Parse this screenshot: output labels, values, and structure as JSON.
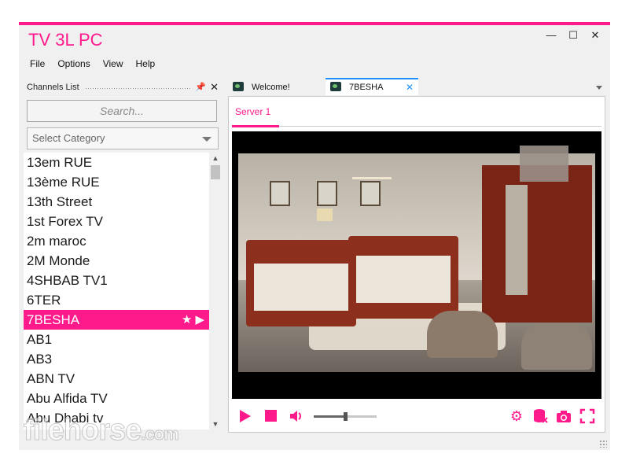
{
  "app": {
    "title": "TV 3L PC",
    "window_controls": {
      "minimize": "—",
      "maximize": "☐",
      "close": "✕"
    }
  },
  "menu": [
    "File",
    "Options",
    "View",
    "Help"
  ],
  "channels_panel": {
    "title": "Channels List",
    "pin_icon": "📌",
    "close_icon": "✕",
    "search_placeholder": "Search...",
    "category_label": "Select Category",
    "channels": [
      "13em RUE",
      "13ème RUE",
      "13th Street",
      "1st Forex TV",
      "2m maroc",
      "2M Monde",
      "4SHBAB TV1",
      "6TER",
      "7BESHA",
      "AB1",
      "AB3",
      "ABN TV",
      "Abu Alfida TV",
      "Abu Dhabi tv"
    ],
    "selected_channel": "7BESHA",
    "selected_actions": "★ ▶"
  },
  "tabs": [
    {
      "label": "Welcome!",
      "active": false
    },
    {
      "label": "7BESHA",
      "active": true,
      "close": "✕"
    }
  ],
  "player": {
    "server_tab": "Server 1",
    "volume_level": 0.5,
    "icons": {
      "play": "play-icon",
      "stop": "stop-icon",
      "volume": "volume-icon",
      "settings": "gear-icon",
      "record": "database-icon",
      "snapshot": "camera-icon",
      "fullscreen": "fullscreen-icon"
    }
  },
  "watermark": {
    "brand": "filehorse",
    "tld": ".com"
  },
  "colors": {
    "accent": "#ff1a8c",
    "tab_active_border": "#1e90ff"
  }
}
